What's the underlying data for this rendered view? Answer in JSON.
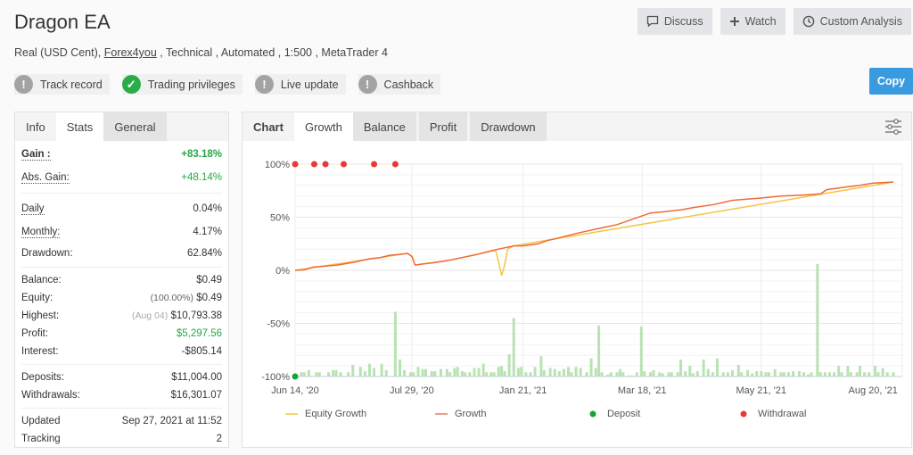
{
  "header": {
    "title": "Dragon EA",
    "subtitle_prefix": "Real (USD Cent), ",
    "broker_link": "Forex4you",
    "subtitle_suffix": " , Technical , Automated , 1:500 , MetaTrader 4"
  },
  "badges": [
    {
      "label": "Track record",
      "status": "warning",
      "icon": "exclamation-icon"
    },
    {
      "label": "Trading privileges",
      "status": "ok",
      "icon": "check-icon"
    },
    {
      "label": "Live update",
      "status": "warning",
      "icon": "exclamation-icon"
    },
    {
      "label": "Cashback",
      "status": "warning",
      "icon": "exclamation-icon"
    }
  ],
  "actions": {
    "discuss": "Discuss",
    "watch": "Watch",
    "custom_analysis": "Custom Analysis",
    "copy": "Copy"
  },
  "left_tabs": {
    "info": "Info",
    "stats": "Stats",
    "general": "General"
  },
  "stats": {
    "gain": {
      "label": "Gain :",
      "value": "+83.18%"
    },
    "abs_gain": {
      "label": "Abs. Gain:",
      "value": "+48.14%"
    },
    "daily": {
      "label": "Daily",
      "value": "0.04%"
    },
    "monthly": {
      "label": "Monthly:",
      "value": "4.17%"
    },
    "drawdown": {
      "label": "Drawdown:",
      "value": "62.84%"
    },
    "balance": {
      "label": "Balance:",
      "value": "$0.49"
    },
    "equity": {
      "label": "Equity:",
      "note": "(100.00%)",
      "value": "$0.49"
    },
    "highest": {
      "label": "Highest:",
      "note": "(Aug 04)",
      "value": "$10,793.38"
    },
    "profit": {
      "label": "Profit:",
      "value": "$5,297.56"
    },
    "interest": {
      "label": "Interest:",
      "value": "-$805.14"
    },
    "deposits": {
      "label": "Deposits:",
      "value": "$11,004.00"
    },
    "withdrawals": {
      "label": "Withdrawals:",
      "value": "$16,301.07"
    },
    "updated": {
      "label": "Updated",
      "value": "Sep 27, 2021 at 11:52"
    },
    "tracking": {
      "label": "Tracking",
      "value": "2"
    }
  },
  "chart_tabs": {
    "chart": "Chart",
    "growth": "Growth",
    "balance": "Balance",
    "profit": "Profit",
    "drawdown": "Drawdown"
  },
  "colors": {
    "equity": "#f5c542",
    "growth": "#ef6b3a",
    "deposit": "#13a538",
    "withdrawal": "#e8393a",
    "bars": "#b9e2b3"
  },
  "chart_data": {
    "type": "line",
    "title": "Growth",
    "xlabel": "",
    "ylabel": "",
    "ylim": [
      -100,
      100
    ],
    "yticks": [
      "100%",
      "50%",
      "0%",
      "-50%",
      "-100%"
    ],
    "ytick_values": [
      100,
      50,
      0,
      -50,
      -100
    ],
    "xticks": [
      "Jun 14, '20",
      "Jul 29, '20",
      "Jan 21, '21",
      "Mar 18, '21",
      "May 21, '21",
      "Aug 20, '21"
    ],
    "xtick_positions": [
      0,
      0.195,
      0.381,
      0.58,
      0.779,
      0.966
    ],
    "legend": [
      "Equity Growth",
      "Growth",
      "Deposit",
      "Withdrawal"
    ],
    "legend_position": "bottom",
    "grid": true,
    "series": [
      {
        "name": "Growth",
        "points": [
          [
            0,
            0
          ],
          [
            0.03,
            0.5
          ],
          [
            0.06,
            3
          ],
          [
            0.1,
            4
          ],
          [
            0.14,
            5
          ],
          [
            0.18,
            7
          ],
          [
            0.2,
            8
          ],
          [
            0.23,
            10
          ],
          [
            0.25,
            11
          ],
          [
            0.28,
            12
          ],
          [
            0.31,
            14
          ],
          [
            0.34,
            15
          ],
          [
            0.37,
            16
          ],
          [
            0.385,
            13
          ],
          [
            0.395,
            5
          ],
          [
            0.42,
            6
          ],
          [
            0.45,
            7
          ],
          [
            0.5,
            9
          ],
          [
            0.55,
            12
          ],
          [
            0.6,
            15
          ],
          [
            0.64,
            18
          ],
          [
            0.67,
            20
          ],
          [
            0.72,
            23
          ],
          [
            0.75,
            23
          ],
          [
            0.8,
            25
          ],
          [
            0.83,
            28
          ],
          [
            0.86,
            30
          ],
          [
            0.93,
            35
          ],
          [
            1.01,
            40
          ],
          [
            1.06,
            43
          ],
          [
            1.1,
            47
          ],
          [
            1.17,
            54
          ],
          [
            1.21,
            55
          ],
          [
            1.27,
            57
          ],
          [
            1.31,
            59
          ],
          [
            1.38,
            62
          ],
          [
            1.44,
            66
          ],
          [
            1.53,
            68
          ],
          [
            1.6,
            70
          ],
          [
            1.68,
            71
          ],
          [
            1.73,
            72
          ],
          [
            1.75,
            76
          ],
          [
            1.8,
            78
          ],
          [
            1.86,
            80
          ],
          [
            1.9,
            82
          ],
          [
            1.97,
            83.18
          ]
        ]
      },
      {
        "name": "Equity Growth",
        "points": [
          [
            0,
            0
          ],
          [
            0.37,
            16
          ],
          [
            0.385,
            13
          ],
          [
            0.395,
            5
          ],
          [
            0.5,
            9
          ],
          [
            0.66,
            19
          ],
          [
            0.67,
            8
          ],
          [
            0.68,
            -5
          ],
          [
            0.69,
            5
          ],
          [
            0.7,
            20
          ],
          [
            0.72,
            23
          ],
          [
            1.97,
            83.18
          ]
        ]
      }
    ],
    "deposit_points": [
      [
        0,
        -100
      ]
    ],
    "withdrawal_points": [
      [
        0,
        100
      ],
      [
        0.063,
        100
      ],
      [
        0.1,
        100
      ],
      [
        0.16,
        100
      ],
      [
        0.26,
        100
      ],
      [
        0.33,
        100
      ]
    ],
    "bar_x_span": [
      0,
      1.97
    ],
    "bars": [
      [
        0.02,
        -96
      ],
      [
        0.03,
        -96
      ],
      [
        0.045,
        -94
      ],
      [
        0.07,
        -96
      ],
      [
        0.08,
        -96
      ],
      [
        0.11,
        -96
      ],
      [
        0.125,
        -94
      ],
      [
        0.135,
        -94
      ],
      [
        0.15,
        -96
      ],
      [
        0.175,
        -96
      ],
      [
        0.19,
        -89
      ],
      [
        0.215,
        -91
      ],
      [
        0.23,
        -95
      ],
      [
        0.245,
        -88
      ],
      [
        0.26,
        -92
      ],
      [
        0.285,
        -88
      ],
      [
        0.3,
        -94
      ],
      [
        0.33,
        -39
      ],
      [
        0.345,
        -84
      ],
      [
        0.36,
        -94
      ],
      [
        0.38,
        -96
      ],
      [
        0.39,
        -96
      ],
      [
        0.405,
        -91
      ],
      [
        0.42,
        -93
      ],
      [
        0.43,
        -93
      ],
      [
        0.45,
        -95
      ],
      [
        0.46,
        -95
      ],
      [
        0.48,
        -93
      ],
      [
        0.5,
        -93
      ],
      [
        0.51,
        -96
      ],
      [
        0.525,
        -92
      ],
      [
        0.535,
        -91
      ],
      [
        0.55,
        -95
      ],
      [
        0.56,
        -96
      ],
      [
        0.575,
        -96
      ],
      [
        0.59,
        -92
      ],
      [
        0.605,
        -92
      ],
      [
        0.62,
        -88
      ],
      [
        0.63,
        -96
      ],
      [
        0.645,
        -96
      ],
      [
        0.655,
        -96
      ],
      [
        0.67,
        -91
      ],
      [
        0.68,
        -90
      ],
      [
        0.69,
        -95
      ],
      [
        0.705,
        -79
      ],
      [
        0.72,
        -45
      ],
      [
        0.735,
        -92
      ],
      [
        0.745,
        -91
      ],
      [
        0.76,
        -96
      ],
      [
        0.775,
        -96
      ],
      [
        0.79,
        -91
      ],
      [
        0.81,
        -81
      ],
      [
        0.82,
        -94
      ],
      [
        0.84,
        -92
      ],
      [
        0.855,
        -93
      ],
      [
        0.87,
        -95
      ],
      [
        0.885,
        -93
      ],
      [
        0.9,
        -91
      ],
      [
        0.91,
        -96
      ],
      [
        0.925,
        -91
      ],
      [
        0.94,
        -92
      ],
      [
        0.96,
        -96
      ],
      [
        0.975,
        -83
      ],
      [
        0.99,
        -92
      ],
      [
        1.0,
        -52
      ],
      [
        1.01,
        -96
      ],
      [
        1.03,
        -98
      ],
      [
        1.04,
        -96
      ],
      [
        1.06,
        -96
      ],
      [
        1.07,
        -93
      ],
      [
        1.08,
        -96
      ],
      [
        1.1,
        -99
      ],
      [
        1.11,
        -99
      ],
      [
        1.125,
        -96
      ],
      [
        1.14,
        -53
      ],
      [
        1.15,
        -95
      ],
      [
        1.17,
        -96
      ],
      [
        1.18,
        -94
      ],
      [
        1.2,
        -96
      ],
      [
        1.21,
        -97
      ],
      [
        1.23,
        -96
      ],
      [
        1.24,
        -96
      ],
      [
        1.26,
        -96
      ],
      [
        1.27,
        -84
      ],
      [
        1.285,
        -95
      ],
      [
        1.3,
        -90
      ],
      [
        1.31,
        -97
      ],
      [
        1.325,
        -95
      ],
      [
        1.345,
        -84
      ],
      [
        1.36,
        -93
      ],
      [
        1.375,
        -96
      ],
      [
        1.39,
        -83
      ],
      [
        1.41,
        -96
      ],
      [
        1.425,
        -96
      ],
      [
        1.44,
        -94
      ],
      [
        1.46,
        -89
      ],
      [
        1.47,
        -96
      ],
      [
        1.49,
        -94
      ],
      [
        1.505,
        -97
      ],
      [
        1.52,
        -95
      ],
      [
        1.535,
        -95
      ],
      [
        1.55,
        -96
      ],
      [
        1.56,
        -96
      ],
      [
        1.58,
        -93
      ],
      [
        1.6,
        -96
      ],
      [
        1.61,
        -96
      ],
      [
        1.625,
        -96
      ],
      [
        1.64,
        -95
      ],
      [
        1.66,
        -95
      ],
      [
        1.675,
        -96
      ],
      [
        1.69,
        -98
      ],
      [
        1.7,
        -96
      ],
      [
        1.72,
        6
      ],
      [
        1.73,
        -96
      ],
      [
        1.745,
        -96
      ],
      [
        1.76,
        -96
      ],
      [
        1.775,
        -96
      ],
      [
        1.79,
        -90
      ],
      [
        1.8,
        -96
      ],
      [
        1.82,
        -90
      ],
      [
        1.83,
        -96
      ],
      [
        1.85,
        -96
      ],
      [
        1.86,
        -90
      ],
      [
        1.875,
        -96
      ],
      [
        1.89,
        -96
      ],
      [
        1.91,
        -90
      ],
      [
        1.92,
        -96
      ],
      [
        1.935,
        -92
      ],
      [
        1.95,
        -96
      ],
      [
        1.97,
        -96
      ]
    ]
  },
  "chart_legend": {
    "equity": "Equity Growth",
    "growth": "Growth",
    "deposit": "Deposit",
    "withdrawal": "Withdrawal"
  }
}
